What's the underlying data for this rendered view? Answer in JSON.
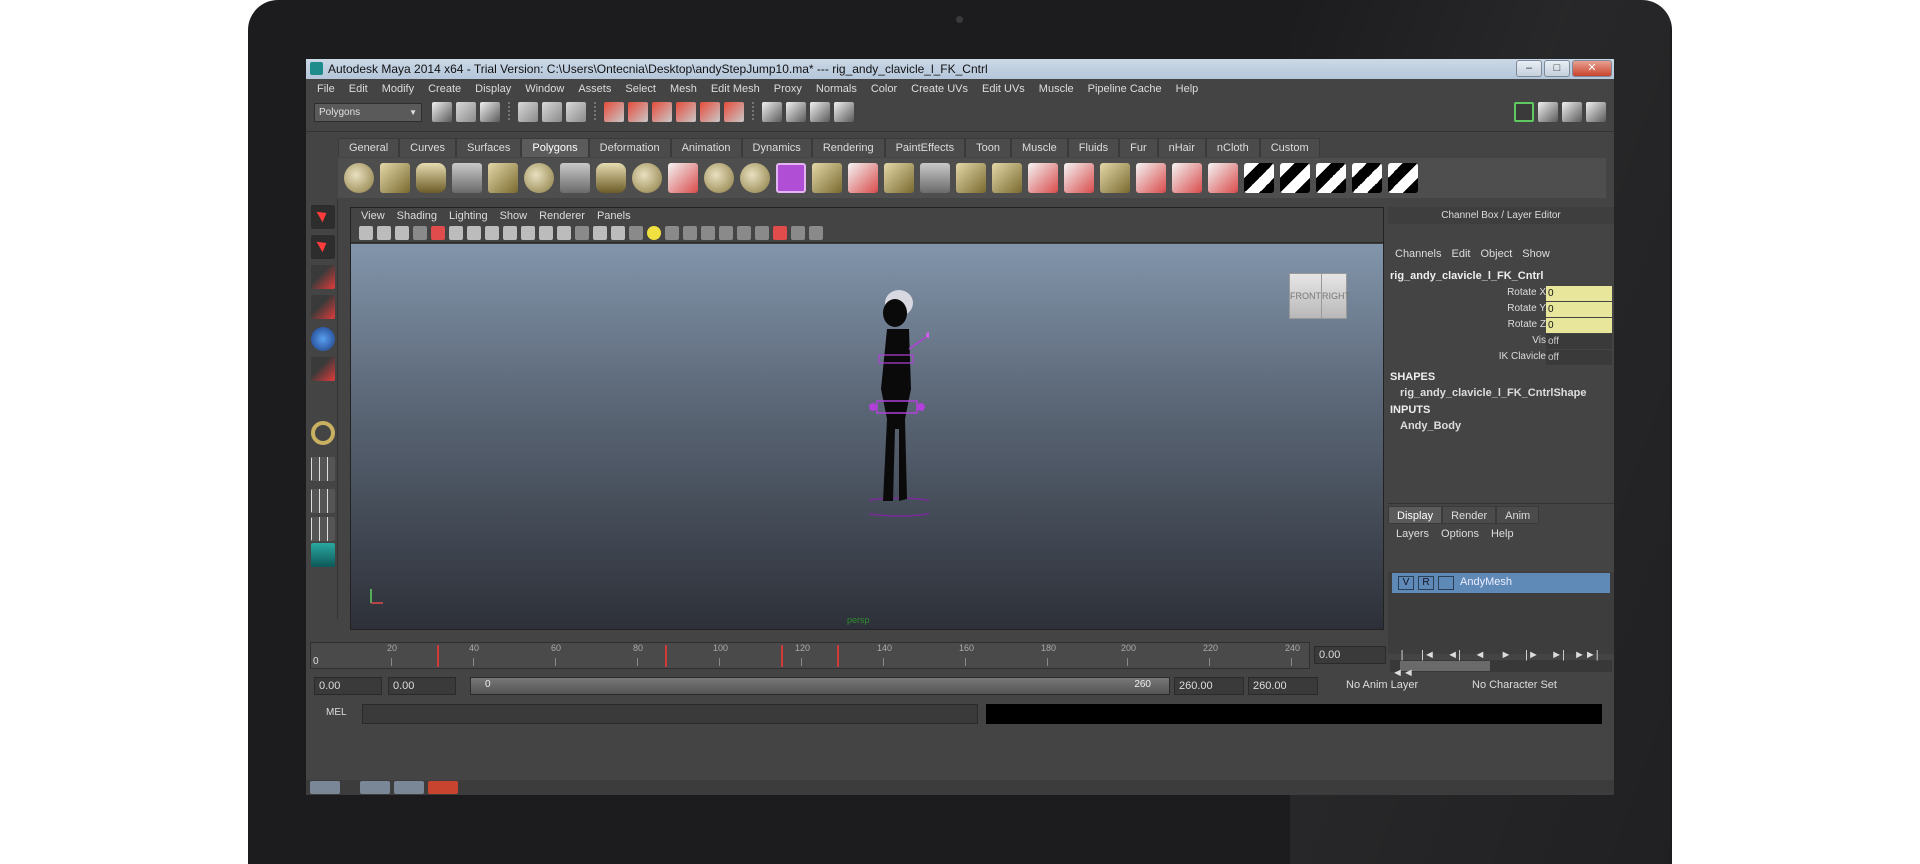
{
  "window": {
    "title": "Autodesk Maya 2014 x64 - Trial Version: C:\\Users\\Ontecnia\\Desktop\\andyStepJump10.ma*  ---  rig_andy_clavicle_l_FK_Cntrl",
    "minimize": "–",
    "maximize": "□",
    "close": "✕"
  },
  "menubar": [
    "File",
    "Edit",
    "Modify",
    "Create",
    "Display",
    "Window",
    "Assets",
    "Select",
    "Mesh",
    "Edit Mesh",
    "Proxy",
    "Normals",
    "Color",
    "Create UVs",
    "Edit UVs",
    "Muscle",
    "Pipeline Cache",
    "Help"
  ],
  "statusline": {
    "mode": "Polygons",
    "mode_arrow": "▼"
  },
  "shelf": {
    "tabs": [
      "General",
      "Curves",
      "Surfaces",
      "Polygons",
      "Deformation",
      "Animation",
      "Dynamics",
      "Rendering",
      "PaintEffects",
      "Toon",
      "Muscle",
      "Fluids",
      "Fur",
      "nHair",
      "nCloth",
      "Custom"
    ],
    "active_tab": "Polygons"
  },
  "viewport": {
    "menu": [
      "View",
      "Shading",
      "Lighting",
      "Show",
      "Renderer",
      "Panels"
    ],
    "viewcube_front": "FRONT",
    "viewcube_right": "RIGHT",
    "camera_label": "persp"
  },
  "channel_box": {
    "title": "Channel Box / Layer Editor",
    "menu": [
      "Channels",
      "Edit",
      "Object",
      "Show"
    ],
    "node": "rig_andy_clavicle_l_FK_Cntrl",
    "attrs": [
      {
        "label": "Rotate X",
        "value": "0"
      },
      {
        "label": "Rotate Y",
        "value": "0"
      },
      {
        "label": "Rotate Z",
        "value": "0"
      },
      {
        "label": "Vis",
        "value": "off"
      },
      {
        "label": "IK Clavicle",
        "value": "off"
      }
    ],
    "shapes_header": "SHAPES",
    "shape_name": "rig_andy_clavicle_l_FK_CntrlShape",
    "inputs_header": "INPUTS",
    "input_name": "Andy_Body"
  },
  "layer_editor": {
    "tabs": [
      "Display",
      "Render",
      "Anim"
    ],
    "active_tab": "Display",
    "menu": [
      "Layers",
      "Options",
      "Help"
    ],
    "layer": {
      "v": "V",
      "r": "R",
      "name": "AndyMesh"
    }
  },
  "timeline": {
    "ticks": [
      "20",
      "40",
      "60",
      "80",
      "100",
      "120",
      "140",
      "160",
      "180",
      "200",
      "220",
      "240"
    ],
    "current_frame": "0",
    "current_time": "0.00",
    "playback": [
      "|◄◄",
      "|◄",
      "◄|",
      "◄",
      "►",
      "|►",
      "►|",
      "►►|"
    ]
  },
  "range": {
    "start": "0.00",
    "anim_start": "0.00",
    "slider_low": "0",
    "slider_high": "260",
    "anim_end": "260.00",
    "end": "260.00",
    "anim_layer": "No Anim Layer",
    "character_set": "No Character Set"
  },
  "mel": {
    "label": "MEL"
  }
}
